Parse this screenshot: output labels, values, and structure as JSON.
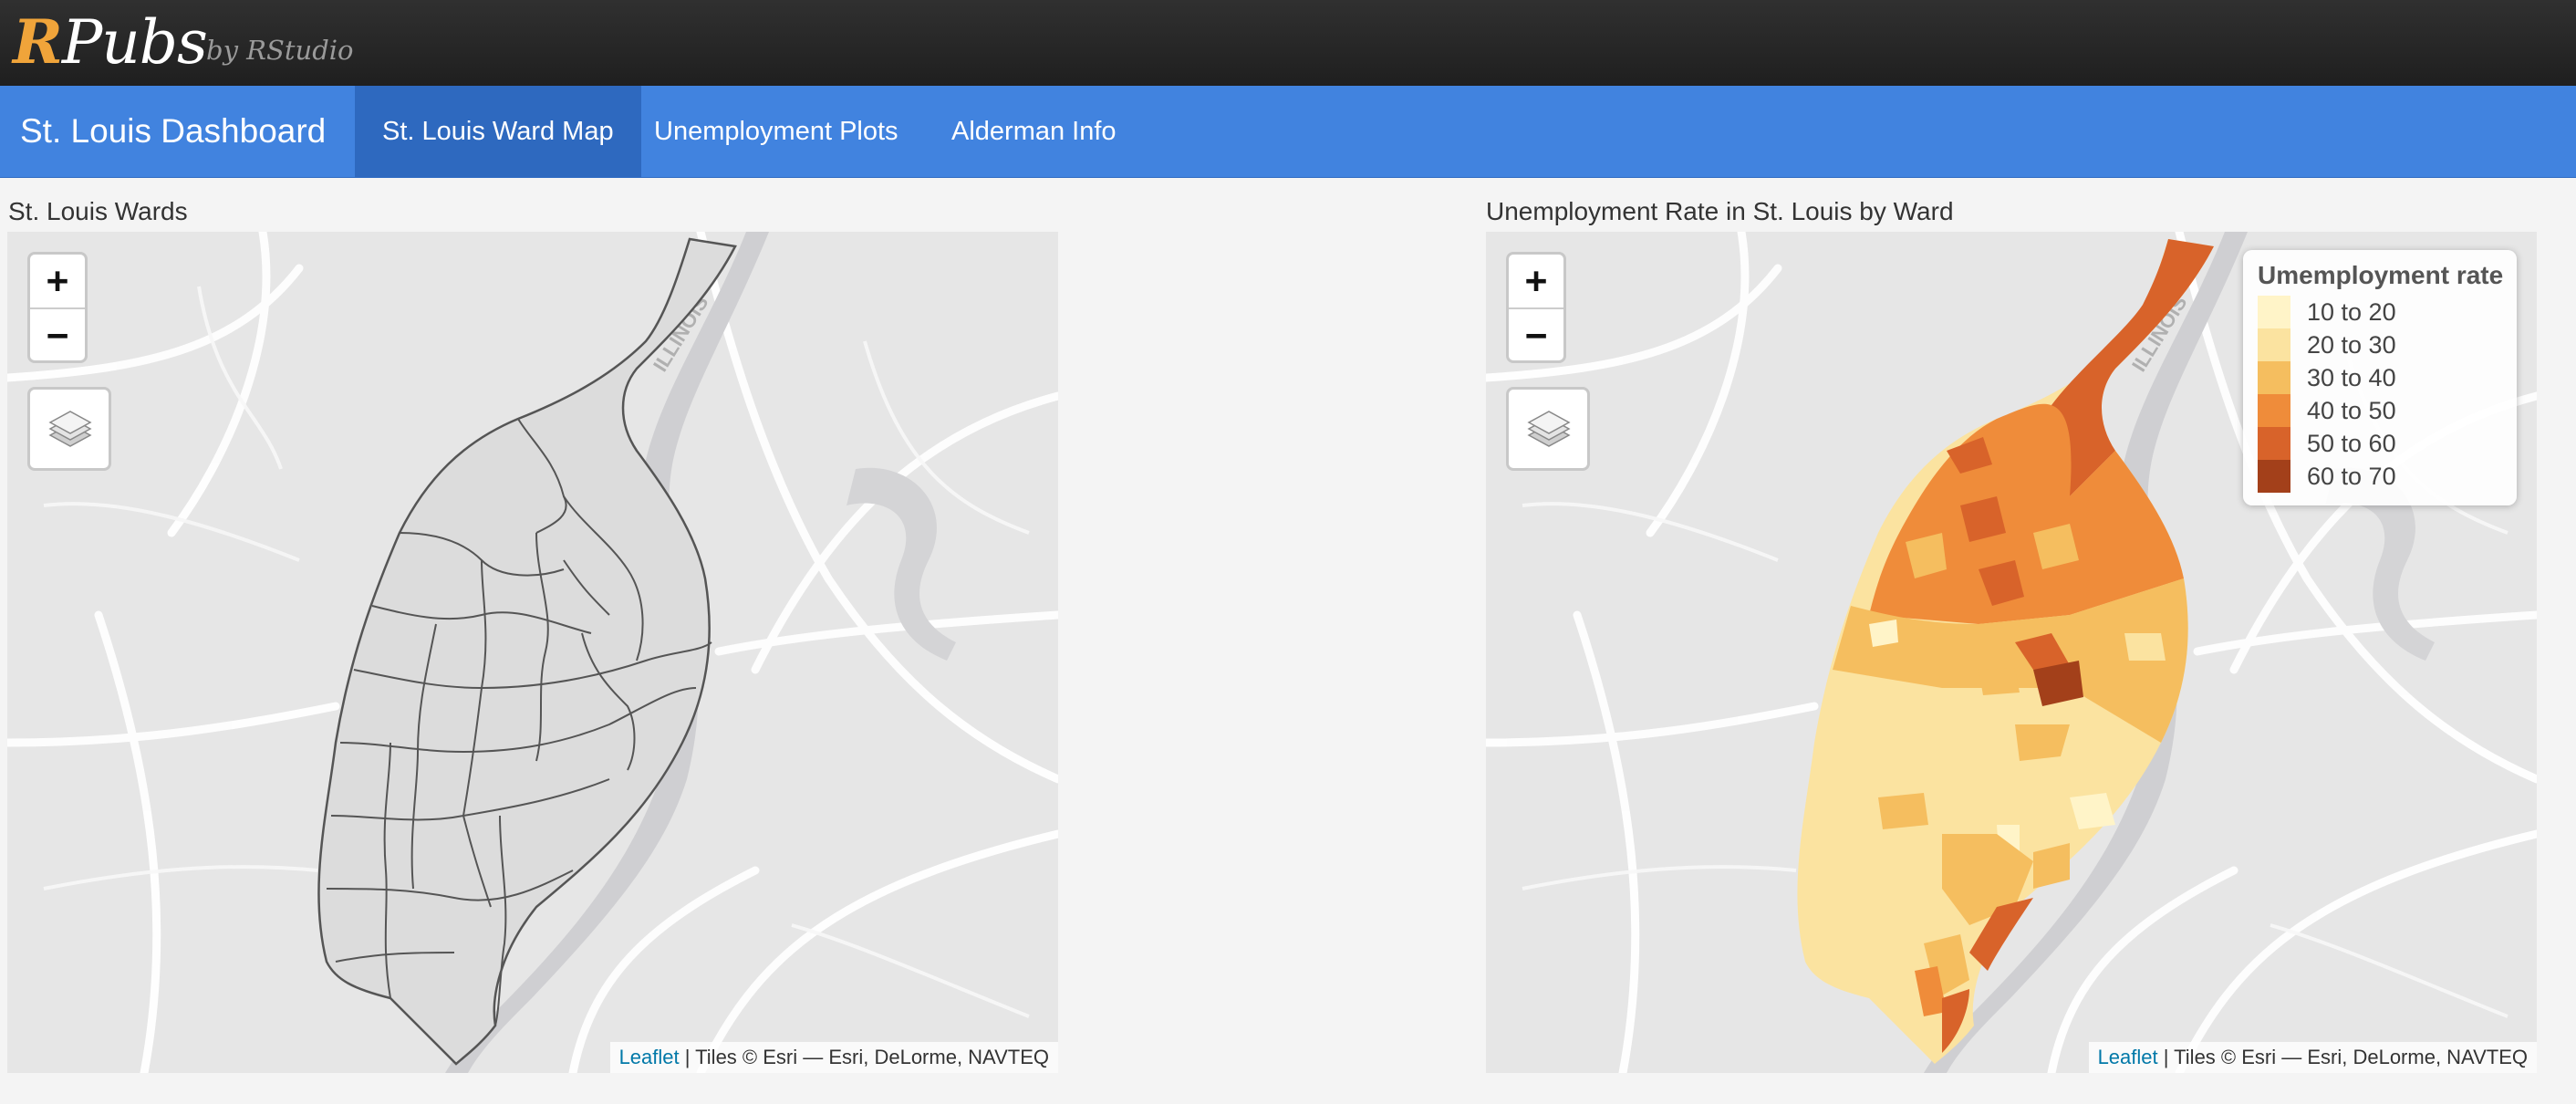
{
  "header": {
    "logo_r": "R",
    "logo_rest": "Pubs",
    "byline": "by RStudio"
  },
  "nav": {
    "brand": "St. Louis Dashboard",
    "tabs": [
      {
        "label": "St. Louis Ward Map",
        "active": true
      },
      {
        "label": "Unemployment Plots",
        "active": false
      },
      {
        "label": "Alderman Info",
        "active": false
      }
    ]
  },
  "panels": {
    "left_title": "St. Louis Wards",
    "right_title": "Unemployment Rate in St. Louis by Ward"
  },
  "map_controls": {
    "zoom_in": "+",
    "zoom_out": "−",
    "layers_icon": "layers-icon"
  },
  "basemap": {
    "state_label": "ILLINOIS"
  },
  "attribution": {
    "link": "Leaflet",
    "text": " | Tiles © Esri — Esri, DeLorme, NAVTEQ"
  },
  "legend": {
    "title": "Umemployment rate",
    "items": [
      {
        "label": "10 to 20",
        "color": "#fff4c8"
      },
      {
        "label": "20 to 30",
        "color": "#fbe3a0"
      },
      {
        "label": "30 to 40",
        "color": "#f5be5f"
      },
      {
        "label": "40 to 50",
        "color": "#ef8c3a"
      },
      {
        "label": "50 to 60",
        "color": "#d8632a"
      },
      {
        "label": "60 to 70",
        "color": "#a3401a"
      }
    ]
  },
  "colors": {
    "topbar": "#262626",
    "navbar": "#4183df",
    "nav_active": "#2e69bf",
    "map_bg": "#e6e6e6",
    "ward_fill": "#dcdcdc",
    "ward_stroke": "#555555"
  }
}
